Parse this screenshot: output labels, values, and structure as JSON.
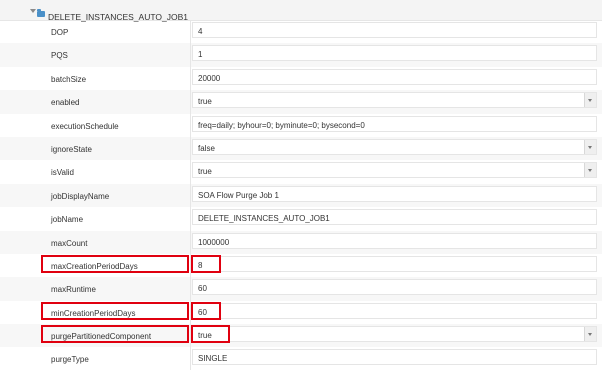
{
  "tree": {
    "node_label": "DELETE_INSTANCES_AUTO_JOB1"
  },
  "rows": [
    {
      "label": "DOP",
      "value": "4",
      "type": "text",
      "highlight": false
    },
    {
      "label": "PQS",
      "value": "1",
      "type": "text",
      "highlight": false
    },
    {
      "label": "batchSize",
      "value": "20000",
      "type": "text",
      "highlight": false
    },
    {
      "label": "enabled",
      "value": "true",
      "type": "select",
      "highlight": false
    },
    {
      "label": "executionSchedule",
      "value": "freq=daily; byhour=0; byminute=0; bysecond=0",
      "type": "text",
      "highlight": false
    },
    {
      "label": "ignoreState",
      "value": "false",
      "type": "select",
      "highlight": false
    },
    {
      "label": "isValid",
      "value": "true",
      "type": "select",
      "highlight": false
    },
    {
      "label": "jobDisplayName",
      "value": "SOA Flow Purge Job 1",
      "type": "text",
      "highlight": false
    },
    {
      "label": "jobName",
      "value": "DELETE_INSTANCES_AUTO_JOB1",
      "type": "text",
      "highlight": false
    },
    {
      "label": "maxCount",
      "value": "1000000",
      "type": "text",
      "highlight": false
    },
    {
      "label": "maxCreationPeriodDays",
      "value": "8",
      "type": "text",
      "highlight": true
    },
    {
      "label": "maxRuntime",
      "value": "60",
      "type": "text",
      "highlight": false
    },
    {
      "label": "minCreationPeriodDays",
      "value": "60",
      "type": "text",
      "highlight": true
    },
    {
      "label": "purgePartitionedComponent",
      "value": "true",
      "type": "select",
      "highlight": true
    },
    {
      "label": "purgeType",
      "value": "SINGLE",
      "type": "text",
      "highlight": false
    }
  ],
  "colors": {
    "highlight": "#e0000f",
    "folder": "#4a90c8"
  }
}
